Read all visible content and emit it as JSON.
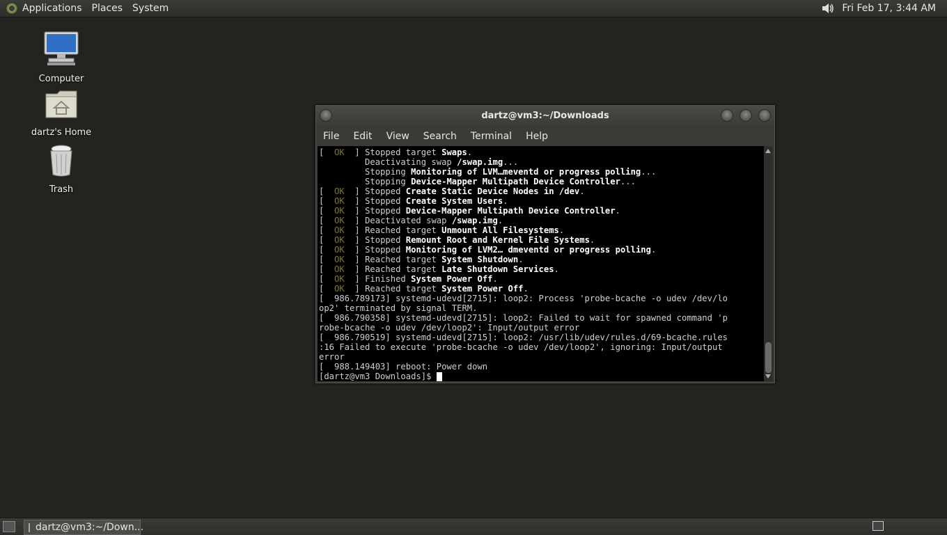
{
  "top_panel": {
    "menus": [
      "Applications",
      "Places",
      "System"
    ],
    "clock": "Fri Feb 17,  3:44 AM"
  },
  "desktop": {
    "icons": [
      {
        "label": "Computer"
      },
      {
        "label": "dartz's Home"
      },
      {
        "label": "Trash"
      }
    ]
  },
  "terminal": {
    "title": "dartz@vm3:~/Downloads",
    "menus": [
      "File",
      "Edit",
      "View",
      "Search",
      "Terminal",
      "Help"
    ],
    "prompt": "[dartz@vm3 Downloads]$ "
  },
  "bottom_panel": {
    "task_label": "dartz@vm3:~/Down..."
  },
  "colors": {
    "desktop_bg": "#23241f",
    "ok": "#7a7a30",
    "terminal_bg": "#000000"
  }
}
